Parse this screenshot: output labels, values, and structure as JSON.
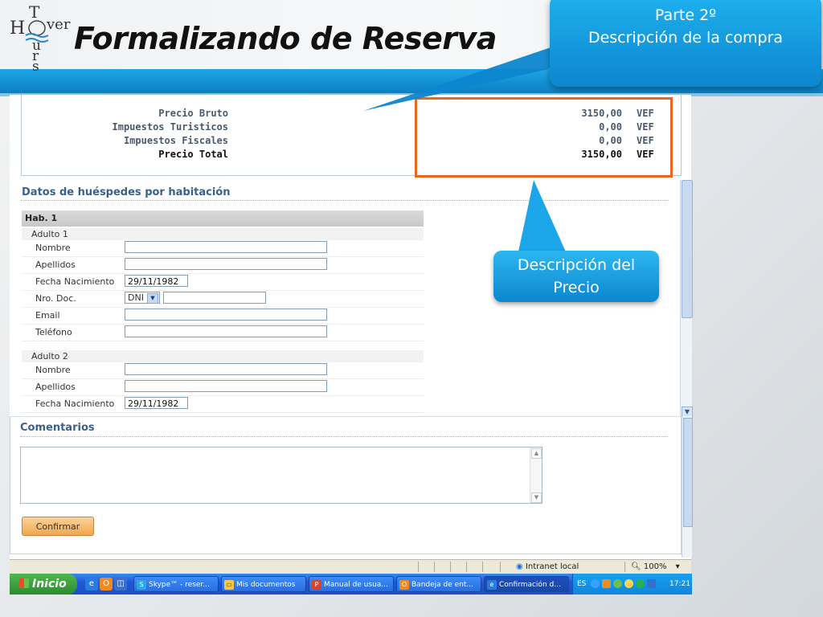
{
  "slide": {
    "title": "Formalizando de Reserva",
    "logo": {
      "top": "T",
      "mid": "H",
      "mid2": "ver",
      "bottom1": "u",
      "bottom2": "r",
      "bottom3": "s"
    },
    "callout_part": {
      "line1": "Parte 2º",
      "line2": "Descripción de la compra"
    },
    "callout_desc": {
      "line1": "Descripción del",
      "line2": "Precio"
    }
  },
  "summary": {
    "rows": [
      {
        "label": "Precio Bruto",
        "value": "3150,00",
        "currency": "VEF"
      },
      {
        "label": "Impuestos Turisticos",
        "value": "0,00",
        "currency": "VEF"
      },
      {
        "label": "Impuestos Fiscales",
        "value": "0,00",
        "currency": "VEF"
      },
      {
        "label": "Precio Total",
        "value": "3150,00",
        "currency": "VEF"
      }
    ]
  },
  "guests": {
    "section_title": "Datos de huéspedes por habitación",
    "room_label": "Hab. 1",
    "adult1": {
      "label": "Adulto 1",
      "nombre": "Nombre",
      "apellidos": "Apellidos",
      "fecha": "Fecha Nacimiento",
      "fecha_value": "29/11/1982",
      "doc": "Nro. Doc.",
      "doc_type": "DNI",
      "email": "Email",
      "telefono": "Teléfono"
    },
    "adult2": {
      "label": "Adulto 2",
      "nombre": "Nombre",
      "apellidos": "Apellidos",
      "fecha": "Fecha Nacimiento",
      "fecha_value": "29/11/1982"
    }
  },
  "comments": {
    "title": "Comentarios",
    "confirm": "Confirmar"
  },
  "statusbar": {
    "zone": "Intranet local",
    "zoom": "100%"
  },
  "taskbar": {
    "start": "Inicio",
    "tasks": [
      {
        "label": "Skype™ - reser..."
      },
      {
        "label": "Mis documentos"
      },
      {
        "label": "Manual de usua..."
      },
      {
        "label": "Bandeja de ent..."
      },
      {
        "label": "Confirmación d..."
      }
    ],
    "lang": "ES",
    "clock": "17:21"
  },
  "colors": {
    "accent_blue": "#0c86cf",
    "highlight_orange": "#e8681c",
    "button_orange": "#f2a64b"
  }
}
